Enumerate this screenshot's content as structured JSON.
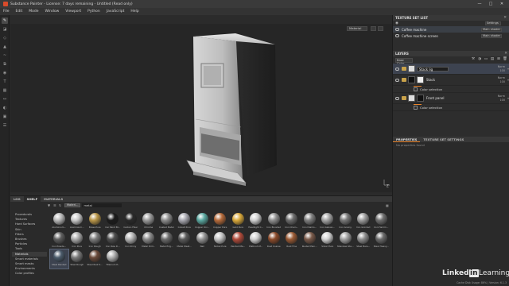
{
  "window": {
    "title": "Substance Painter - License: 7 days remaining - Untitled (Read only)",
    "controls": [
      "—",
      "□",
      "✕"
    ]
  },
  "menu": [
    "File",
    "Edit",
    "Mode",
    "Window",
    "Viewport",
    "Python",
    "JavaScript",
    "Help"
  ],
  "viewport": {
    "display_mode": "Material"
  },
  "texture_set_list": {
    "title": "TEXTURE SET LIST",
    "settings_label": "Settings",
    "sets": [
      {
        "name": "Coffee machine",
        "shader": "Main shader",
        "selected": true
      },
      {
        "name": "Coffee machine screen",
        "shader": "Main shader",
        "selected": false
      }
    ]
  },
  "layers": {
    "title": "LAYERS",
    "blend_mode": "Base Color",
    "items": [
      {
        "name": "Stack lig",
        "type": "folder",
        "blend": "Norm",
        "opacity": "100",
        "selected": true,
        "editing": true
      },
      {
        "name": "Stack",
        "type": "folder",
        "blend": "Norm",
        "opacity": "100",
        "selected": false,
        "sub": "Color selection"
      },
      {
        "name": "Front panel",
        "type": "folder",
        "blend": "Norm",
        "opacity": "100",
        "selected": false,
        "sub": "Color selection"
      }
    ]
  },
  "properties": {
    "tabs": [
      "PROPERTIES",
      "TEXTURE SET SETTINGS"
    ],
    "empty_text": "No properties found"
  },
  "shelf": {
    "tabs": [
      "LOG",
      "SHELF",
      "MATERIALS"
    ],
    "filter_chip": "Materi...",
    "search_value": "metal",
    "categories": [
      "Procedurals",
      "Textures",
      "Hard Surfaces",
      "Skin",
      "Filters",
      "Brushes",
      "Particles",
      "Tools",
      "Materials",
      "Smart materials",
      "Smart masks",
      "Environments",
      "Color profiles"
    ],
    "active_category": "Materials",
    "materials": [
      {
        "label": "Aluminium...",
        "color": "#b8b8b8"
      },
      {
        "label": "Aluminium...",
        "color": "#c9c9c9"
      },
      {
        "label": "Brass Pure",
        "color": "#b89548"
      },
      {
        "label": "Car Paint Bl...",
        "color": "#1b1b1b"
      },
      {
        "label": "Carbon Fiber",
        "color": "#2a2a2a"
      },
      {
        "label": "Chrome",
        "color": "#9a9a9a"
      },
      {
        "label": "Coated Metal",
        "color": "#8c8c8c"
      },
      {
        "label": "Cobalt Pure",
        "color": "#a8a8b0"
      },
      {
        "label": "Copper Oxi...",
        "color": "#5aa8a0"
      },
      {
        "label": "Copper Pure",
        "color": "#b56a3a"
      },
      {
        "label": "Gold Pure",
        "color": "#d9a83a"
      },
      {
        "label": "Headlight C...",
        "color": "#d0d0d0"
      },
      {
        "label": "Iron Brushed",
        "color": "#8e8e8e"
      },
      {
        "label": "Iron Chain...",
        "color": "#6c6c6c"
      },
      {
        "label": "Iron Diamo...",
        "color": "#7e7e7e"
      },
      {
        "label": "Iron Galvan...",
        "color": "#a4a4a4"
      },
      {
        "label": "Iron Grainy",
        "color": "#777777"
      },
      {
        "label": "Iron Grinded",
        "color": "#9c9c9c"
      },
      {
        "label": "Iron Hamm...",
        "color": "#6e6e6e"
      },
      {
        "label": "Iron Powde...",
        "color": "#5e5e5e"
      },
      {
        "label": "Iron Pure",
        "color": "#aaaaaa"
      },
      {
        "label": "Iron Rough",
        "color": "#7a7a7a"
      },
      {
        "label": "Iron Raw D...",
        "color": "#4e4e4e"
      },
      {
        "label": "Iron Shiny",
        "color": "#b4b4b4"
      },
      {
        "label": "Metal Drill...",
        "color": "#8a8a8a"
      },
      {
        "label": "Metal Edg...",
        "color": "#6a6a6a"
      },
      {
        "label": "Metal Weat...",
        "color": "#5a5a5a"
      },
      {
        "label": "Nail",
        "color": "#939393"
      },
      {
        "label": "Nickel Pure",
        "color": "#c2c2c2"
      },
      {
        "label": "Painted Ma...",
        "color": "#b04a3a"
      },
      {
        "label": "Platinum P...",
        "color": "#cfcfcf"
      },
      {
        "label": "Rust Coarse",
        "color": "#8a4a2a"
      },
      {
        "label": "Rust Fine",
        "color": "#9a5a34"
      },
      {
        "label": "Rusted Pain...",
        "color": "#7a5a4a"
      },
      {
        "label": "Silver Pure",
        "color": "#d2d2d2"
      },
      {
        "label": "Stainless Ste...",
        "color": "#a0a0a0"
      },
      {
        "label": "Steel Bare...",
        "color": "#8c8c8c"
      },
      {
        "label": "Steel Heavy...",
        "color": "#6a6a6a"
      },
      {
        "label": "Steel Painted",
        "color": "#4a5a6a"
      },
      {
        "label": "Steel Rough",
        "color": "#7a7a7a"
      },
      {
        "label": "Steel Rust S...",
        "color": "#6a4a3a"
      },
      {
        "label": "Titanium P...",
        "color": "#b0b0b0"
      }
    ],
    "selected_material_index": 38
  },
  "status": {
    "text": "Cache Disk Usage: 86% | Version: 6.1.3"
  },
  "watermark": {
    "part1": "Linked",
    "part2": "in",
    "part3": "Learning"
  },
  "colors": {
    "accent": "#e8832a",
    "panel": "#2d2d2d",
    "selection": "#3d4350"
  }
}
